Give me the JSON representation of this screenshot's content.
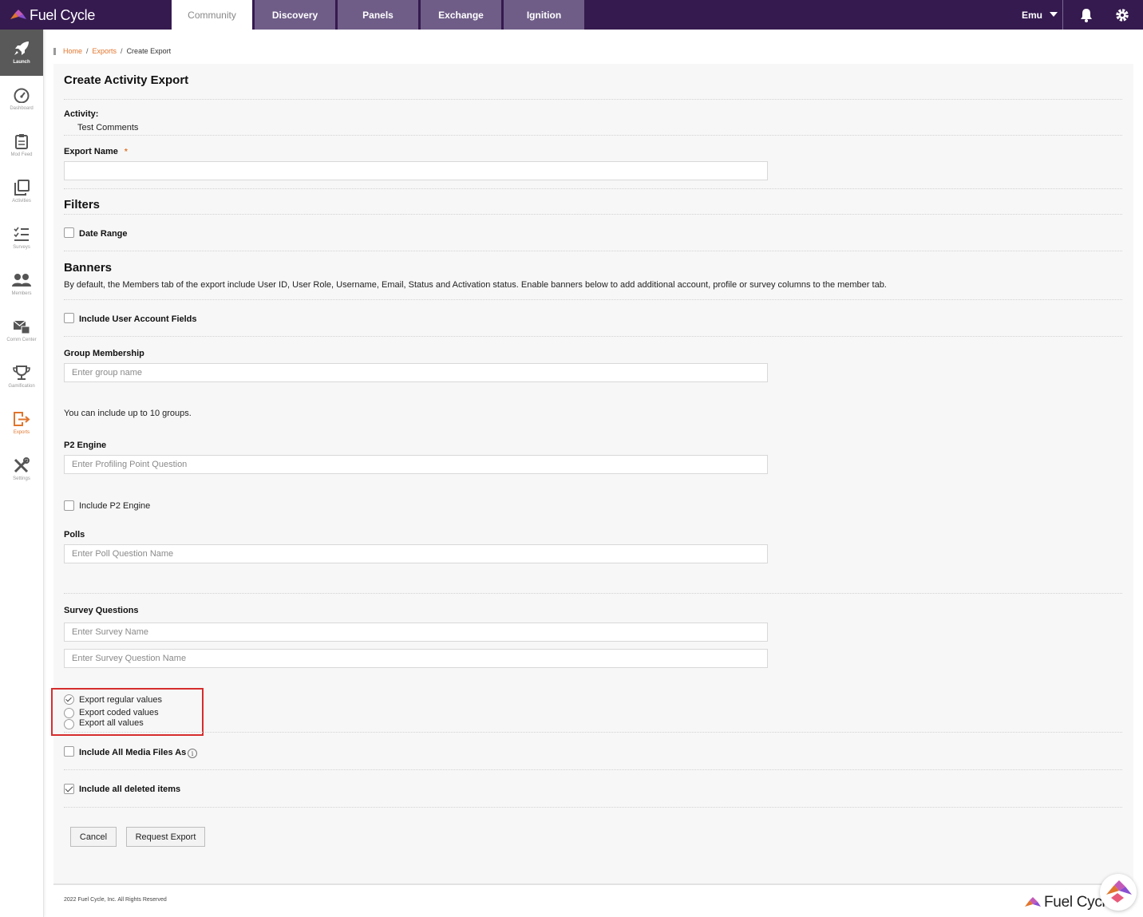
{
  "app": {
    "brand": "Fuel Cycle",
    "colors": {
      "topbar": "#351a4f",
      "tab": "#6f5d88",
      "accent": "#e0752c",
      "highlight": "#d62d2d"
    }
  },
  "topnav": {
    "tabs": [
      {
        "label": "Community",
        "active": true
      },
      {
        "label": "Discovery"
      },
      {
        "label": "Panels"
      },
      {
        "label": "Exchange"
      },
      {
        "label": "Ignition"
      }
    ],
    "user": "Emu",
    "icons": [
      "bell-icon",
      "gear-icon"
    ]
  },
  "sidebar": {
    "items": [
      {
        "label": "Launch",
        "icon": "rocket-icon"
      },
      {
        "label": "Dashboard",
        "icon": "gauge-icon"
      },
      {
        "label": "Mod Feed",
        "icon": "clipboard-icon"
      },
      {
        "label": "Activities",
        "icon": "copy-icon"
      },
      {
        "label": "Surveys",
        "icon": "checklist-icon"
      },
      {
        "label": "Members",
        "icon": "users-icon"
      },
      {
        "label": "Comm Center",
        "icon": "mail-icon"
      },
      {
        "label": "Gamification",
        "icon": "trophy-icon"
      },
      {
        "label": "Exports",
        "icon": "export-icon",
        "active": true
      },
      {
        "label": "Settings",
        "icon": "tools-icon"
      }
    ]
  },
  "breadcrumb": {
    "home": "Home",
    "exports": "Exports",
    "current": "Create Export",
    "sep": "/"
  },
  "form": {
    "title": "Create Activity Export",
    "activity_label": "Activity:",
    "activity_value": "Test Comments",
    "export_name_label": "Export Name",
    "required_mark": "*",
    "export_name_value": "",
    "filters_heading": "Filters",
    "date_range_label": "Date Range",
    "banners_heading": "Banners",
    "banners_desc": "By default, the Members tab of the export include User ID, User Role, Username, Email, Status and Activation status. Enable banners below to add additional account, profile or survey columns to the member tab.",
    "include_user_account_label": "Include User Account Fields",
    "group_membership_label": "Group Membership",
    "group_placeholder": "Enter group name",
    "group_hint": "You can include up to 10 groups.",
    "p2_label": "P2 Engine",
    "p2_placeholder": "Enter Profiling Point Question",
    "include_p2_label": "Include P2 Engine",
    "polls_label": "Polls",
    "polls_placeholder": "Enter Poll Question Name",
    "survey_questions_label": "Survey Questions",
    "survey_name_placeholder": "Enter Survey Name",
    "survey_question_placeholder": "Enter Survey Question Name",
    "export_options": [
      {
        "label": "Export regular values",
        "checked": true
      },
      {
        "label": "Export coded values",
        "checked": false
      },
      {
        "label": "Export all values",
        "checked": false
      }
    ],
    "include_media_label": "Include All Media Files As",
    "info_glyph": "i",
    "include_deleted_label": "Include all deleted items",
    "include_deleted_checked": true,
    "cancel_label": "Cancel",
    "request_label": "Request Export"
  },
  "footer": {
    "copyright": "2022 Fuel Cycle, Inc. All Rights Reserved",
    "logo_text": "Fuel Cycle"
  }
}
